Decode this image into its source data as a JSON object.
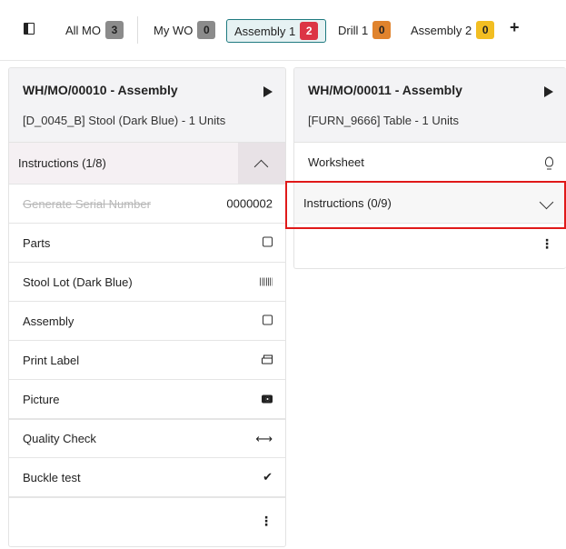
{
  "tabs": [
    {
      "label": "All MO",
      "count": "3",
      "badge_color": "#8b8b8b"
    },
    {
      "label": "My WO",
      "count": "0",
      "badge_color": "#8b8b8b"
    },
    {
      "label": "Assembly 1",
      "count": "2",
      "badge_color": "#dc3545",
      "active": true
    },
    {
      "label": "Drill 1",
      "count": "0",
      "badge_color": "#e0832d"
    },
    {
      "label": "Assembly 2",
      "count": "0",
      "badge_color": "#f2be22"
    }
  ],
  "add_tab": "+",
  "card1": {
    "title": "WH/MO/00010 - Assembly",
    "subtitle": "[D_0045_B] Stool (Dark Blue) - 1 Units",
    "instructions_label": "Instructions (1/8)",
    "steps": [
      {
        "label": "Generate Serial Number",
        "value": "0000002",
        "done": true,
        "icon": "none"
      },
      {
        "label": "Parts",
        "icon": "checkbox-icon"
      },
      {
        "label": "Stool Lot (Dark Blue)",
        "icon": "barcode-icon"
      },
      {
        "label": "Assembly",
        "icon": "checkbox-icon"
      },
      {
        "label": "Print Label",
        "icon": "print-icon"
      },
      {
        "label": "Picture",
        "icon": "camera-icon"
      },
      {
        "label": "Quality Check",
        "icon": "arrows-horizontal-icon"
      },
      {
        "label": "Buckle test",
        "icon": "check-icon"
      }
    ],
    "menu_glyph": "⋮"
  },
  "card2": {
    "title": "WH/MO/00011 - Assembly",
    "subtitle": "[FURN_9666] Table - 1 Units",
    "worksheet_label": "Worksheet",
    "instructions_label": "Instructions (0/9)",
    "menu_glyph": "⋮"
  },
  "glyphs": {
    "arrows": "⟷",
    "check": "✔"
  },
  "colors": {
    "accent": "#1f7a80",
    "highlight": "#e01919"
  }
}
